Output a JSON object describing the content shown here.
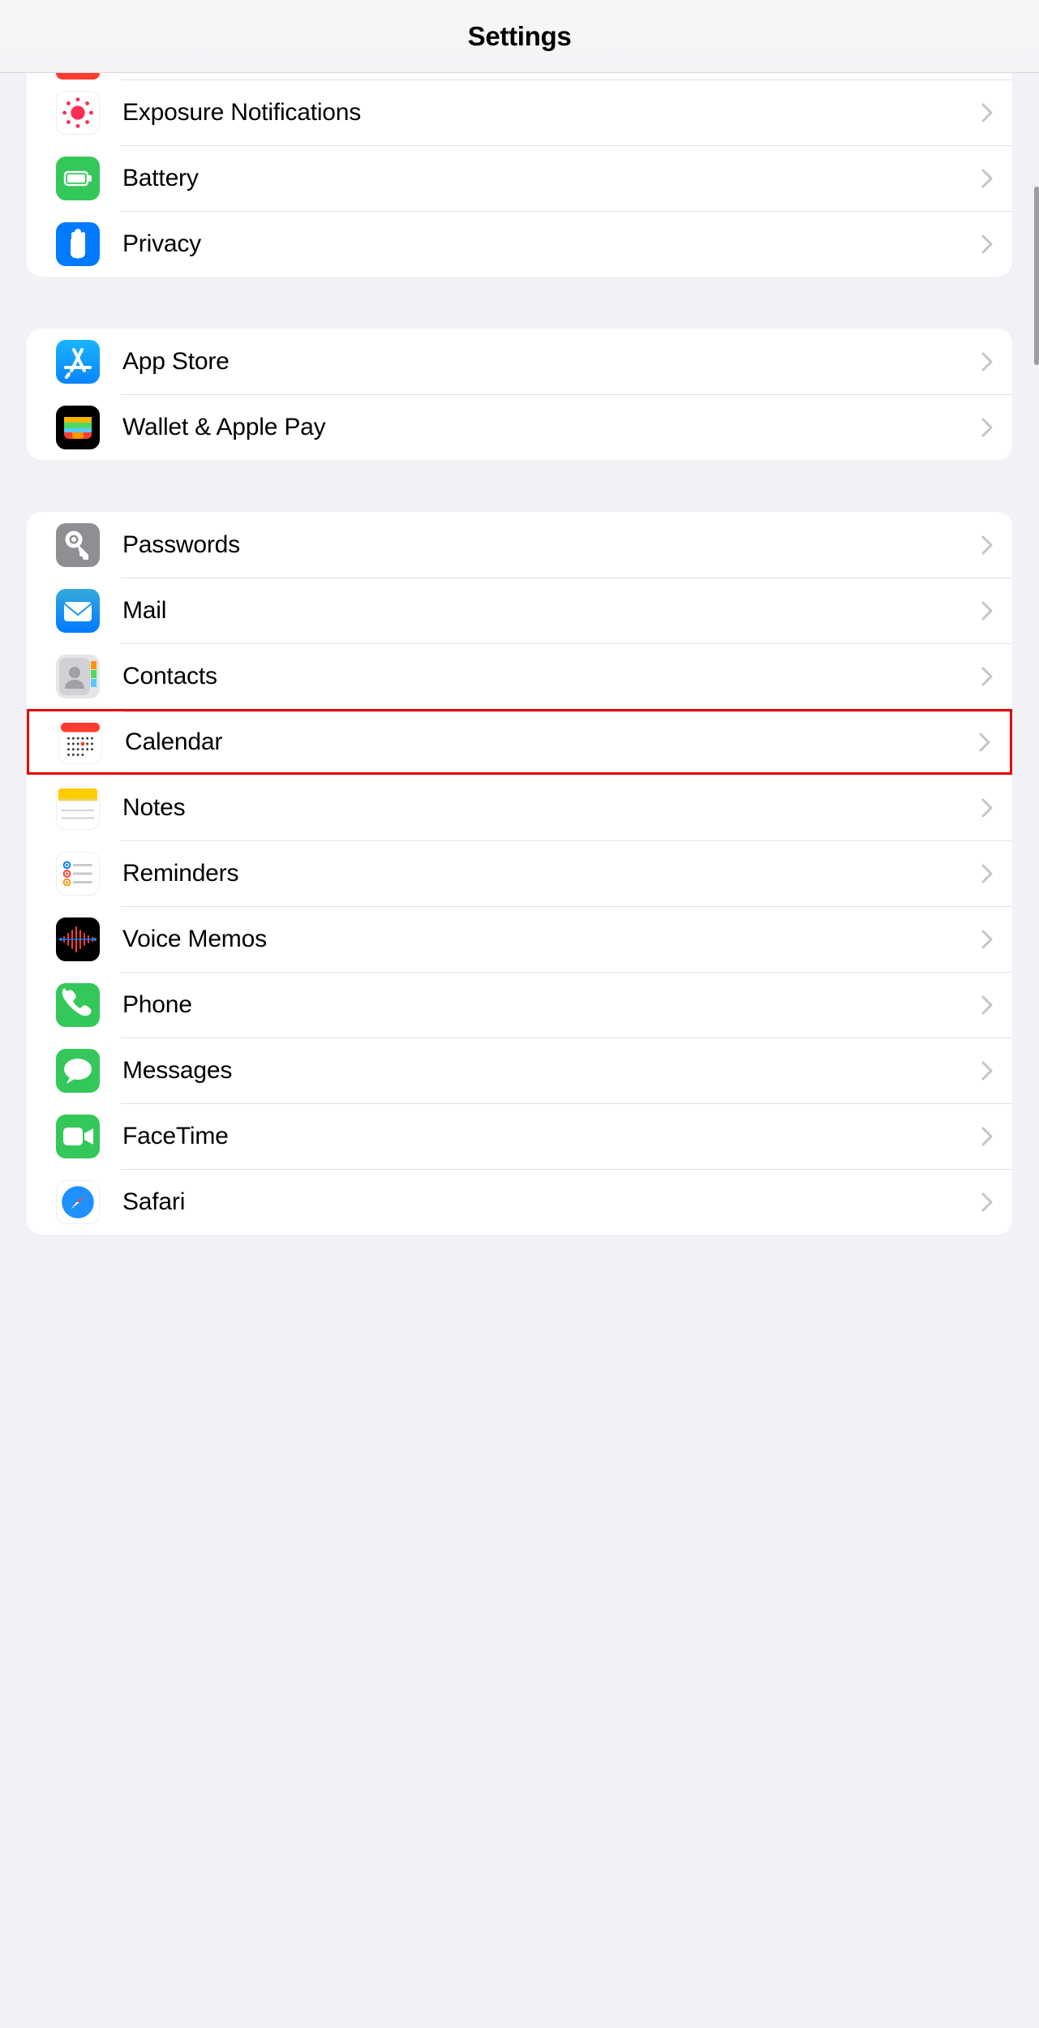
{
  "header": {
    "title": "Settings"
  },
  "groups": [
    {
      "name": "system",
      "rows": [
        {
          "key": "partial-top",
          "label": "",
          "icon": "red-placeholder"
        },
        {
          "key": "exposure-notifications",
          "label": "Exposure Notifications",
          "icon": "exposure"
        },
        {
          "key": "battery",
          "label": "Battery",
          "icon": "battery"
        },
        {
          "key": "privacy",
          "label": "Privacy",
          "icon": "privacy"
        }
      ]
    },
    {
      "name": "store",
      "rows": [
        {
          "key": "app-store",
          "label": "App Store",
          "icon": "appstore"
        },
        {
          "key": "wallet",
          "label": "Wallet & Apple Pay",
          "icon": "wallet"
        }
      ]
    },
    {
      "name": "apps",
      "rows": [
        {
          "key": "passwords",
          "label": "Passwords",
          "icon": "passwords"
        },
        {
          "key": "mail",
          "label": "Mail",
          "icon": "mail"
        },
        {
          "key": "contacts",
          "label": "Contacts",
          "icon": "contacts"
        },
        {
          "key": "calendar",
          "label": "Calendar",
          "icon": "calendar",
          "highlighted": true
        },
        {
          "key": "notes",
          "label": "Notes",
          "icon": "notes"
        },
        {
          "key": "reminders",
          "label": "Reminders",
          "icon": "reminders"
        },
        {
          "key": "voice-memos",
          "label": "Voice Memos",
          "icon": "voicememos"
        },
        {
          "key": "phone",
          "label": "Phone",
          "icon": "phone"
        },
        {
          "key": "messages",
          "label": "Messages",
          "icon": "messages"
        },
        {
          "key": "facetime",
          "label": "FaceTime",
          "icon": "facetime"
        },
        {
          "key": "safari",
          "label": "Safari",
          "icon": "safari"
        }
      ]
    }
  ]
}
